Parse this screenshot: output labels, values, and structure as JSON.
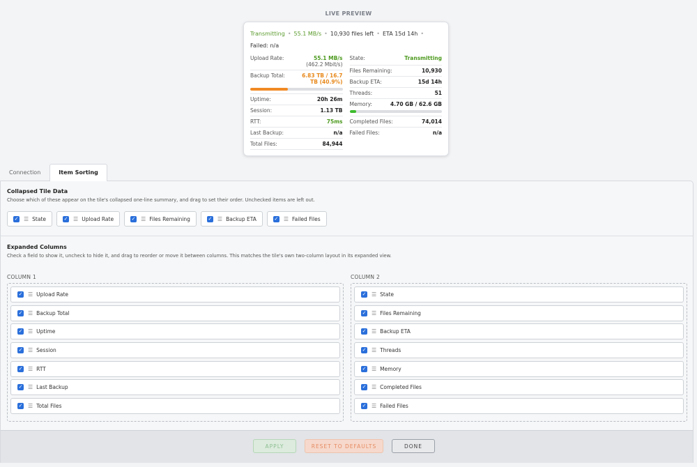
{
  "preview": {
    "heading": "LIVE PREVIEW",
    "summary": {
      "state": "Transmitting",
      "rate": "55.1 MB/s",
      "files_left": "10,930 files left",
      "eta": "ETA 15d 14h",
      "failed": "Failed: n/a"
    },
    "left": {
      "upload_rate": {
        "label": "Upload Rate:",
        "value": "55.1 MB/s",
        "sub": "(462.2 Mbit/s)"
      },
      "backup_total": {
        "label": "Backup Total:",
        "value": "6.83 TB / 16.7 TB (40.9%)",
        "progress": 0.409,
        "bar_color": "#f08a24"
      },
      "uptime": {
        "label": "Uptime:",
        "value": "20h 26m"
      },
      "session": {
        "label": "Session:",
        "value": "1.13 TB"
      },
      "rtt": {
        "label": "RTT:",
        "value": "75ms"
      },
      "last_backup": {
        "label": "Last Backup:",
        "value": "n/a"
      },
      "total_files": {
        "label": "Total Files:",
        "value": "84,944"
      }
    },
    "right": {
      "state": {
        "label": "State:",
        "value": "Transmitting"
      },
      "files_remaining": {
        "label": "Files Remaining:",
        "value": "10,930"
      },
      "backup_eta": {
        "label": "Backup ETA:",
        "value": "15d 14h"
      },
      "threads": {
        "label": "Threads:",
        "value": "51"
      },
      "memory": {
        "label": "Memory:",
        "value": "4.70 GB / 62.6 GB",
        "progress": 0.075,
        "bar_color": "#3dbb2e"
      },
      "completed_files": {
        "label": "Completed Files:",
        "value": "74,014"
      },
      "failed_files": {
        "label": "Failed Files:",
        "value": "n/a"
      }
    }
  },
  "tabs": [
    {
      "label": "Connection"
    },
    {
      "label": "Item Sorting"
    }
  ],
  "collapsed": {
    "title": "Collapsed Tile Data",
    "description": "Choose which of these appear on the tile's collapsed one-line summary, and drag to set their order. Unchecked items are left out.",
    "items": [
      "State",
      "Upload Rate",
      "Files Remaining",
      "Backup ETA",
      "Failed Files"
    ]
  },
  "expanded": {
    "title": "Expanded Columns",
    "description": "Check a field to show it, uncheck to hide it, and drag to reorder or move it between columns. This matches the tile's own two-column layout in its expanded view.",
    "column1_label": "COLUMN 1",
    "column2_label": "COLUMN 2",
    "column1": [
      "Upload Rate",
      "Backup Total",
      "Uptime",
      "Session",
      "RTT",
      "Last Backup",
      "Total Files"
    ],
    "column2": [
      "State",
      "Files Remaining",
      "Backup ETA",
      "Threads",
      "Memory",
      "Completed Files",
      "Failed Files"
    ]
  },
  "footer": {
    "apply": "APPLY",
    "reset": "RESET TO DEFAULTS",
    "done": "DONE"
  },
  "colors": {
    "accent": "#2a6fdb",
    "green": "#4d9a1f",
    "orange": "#e8891c"
  }
}
